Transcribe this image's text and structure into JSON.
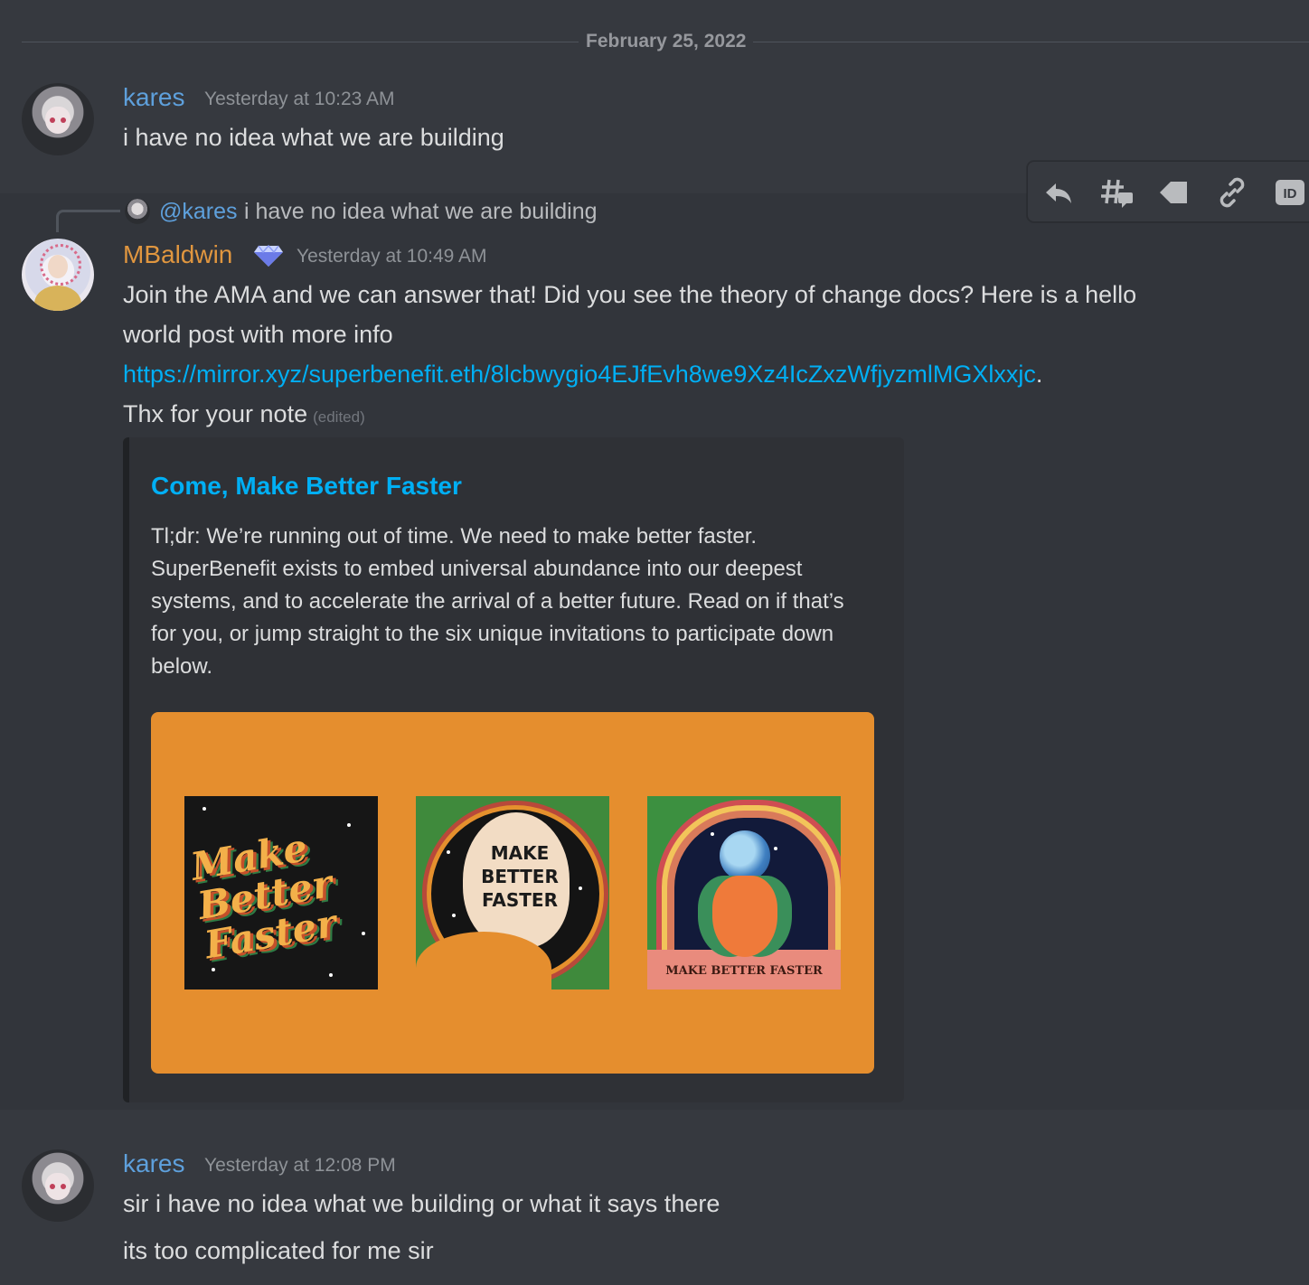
{
  "date_divider": "February 25, 2022",
  "messages": [
    {
      "author": "kares",
      "timestamp": "Yesterday at 10:23 AM",
      "lines": [
        "i have no idea what we are building"
      ]
    },
    {
      "reply": {
        "mention": "@kares",
        "text": "i have no idea what we are building"
      },
      "author": "MBaldwin",
      "timestamp": "Yesterday at 10:49 AM",
      "text_line1": "Join the AMA and we can answer that! Did you see the theory of change docs? Here is a hello",
      "text_line2": "world post with more info",
      "link": "https://mirror.xyz/superbenefit.eth/8lcbwygio4EJfEvh8we9Xz4IcZxzWfjyzmlMGXlxxjc",
      "link_suffix": ".",
      "text_line4": "Thx for your note",
      "edited": "(edited)",
      "embed": {
        "title": "Come, Make Better Faster",
        "description": "Tl;dr:  We’re running out of time. We need to make better faster. SuperBenefit exists to embed universal abundance into our deepest systems, and to accelerate the arrival of a better future. Read on if that’s for you, or jump straight to the six unique invitations to participate down below.",
        "image_art1_text": "Make Better Faster",
        "image_art2_text": "MAKE BETTER FASTER",
        "image_art3_label": "MAKE BETTER FASTER"
      }
    },
    {
      "author": "kares",
      "timestamp": "Yesterday at 12:08 PM",
      "lines": [
        "sir i have no idea what we building or what it says there",
        "its too complicated for me sir"
      ]
    }
  ],
  "toolbar": {
    "icons": [
      "reply-icon",
      "create-thread-icon",
      "mark-unread-icon",
      "copy-link-icon",
      "copy-id-icon"
    ],
    "id_label": "ID"
  },
  "colors": {
    "background": "#36393f",
    "kares_name": "#5ea0dc",
    "mbaldwin_name": "#e0963f",
    "link": "#00aff4",
    "embed_image_bg": "#e58e2e"
  }
}
